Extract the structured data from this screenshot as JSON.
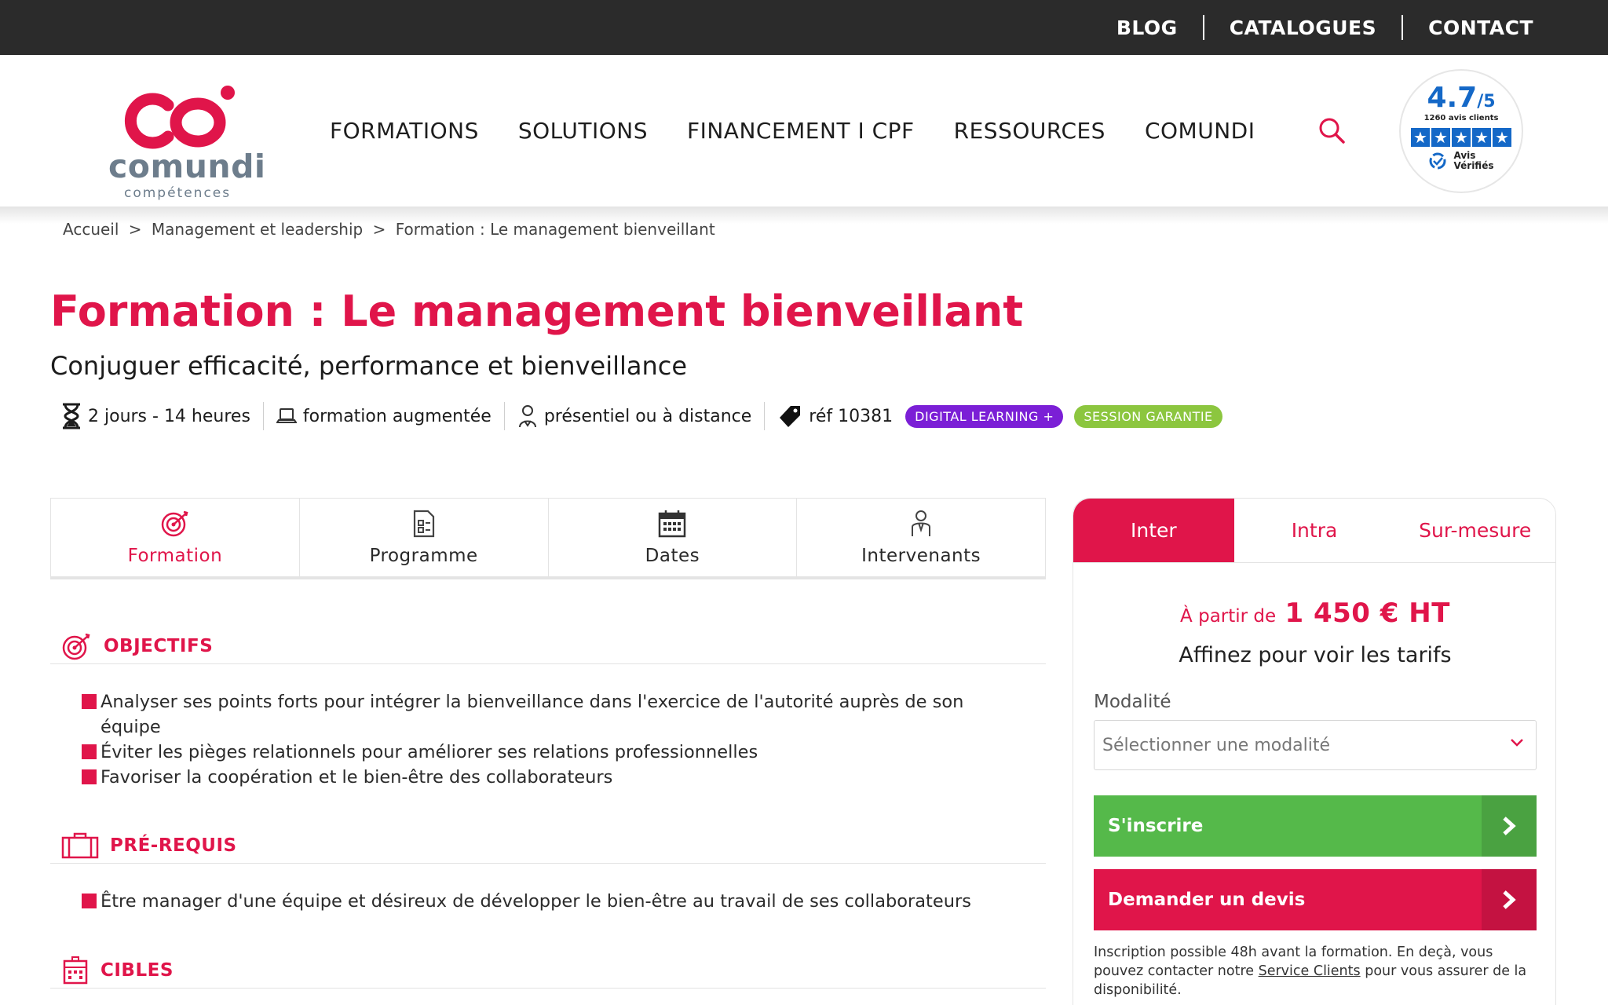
{
  "topbar": {
    "links": [
      "BLOG",
      "CATALOGUES",
      "CONTACT"
    ]
  },
  "logo": {
    "brand": "comundi",
    "sub": "compétences"
  },
  "nav": {
    "items": [
      "FORMATIONS",
      "SOLUTIONS",
      "FINANCEMENT I CPF",
      "RESSOURCES",
      "COMUNDI"
    ]
  },
  "rating": {
    "score": "4.7",
    "scale": "/5",
    "count": "1260 avis clients",
    "stars": 5,
    "brand_line1": "Avis",
    "brand_line2": "Vérifiés"
  },
  "breadcrumb": {
    "home": "Accueil",
    "sep": ">",
    "category": "Management et leadership",
    "current": "Formation : Le management bienveillant"
  },
  "title": "Formation : Le management bienveillant",
  "subtitle": "Conjuguer efficacité, performance et bienveillance",
  "meta": {
    "duration": "2 jours - 14 heures",
    "type": "formation augmentée",
    "mode": "présentiel ou à distance",
    "ref": "réf 10381",
    "badge_digital": "DIGITAL LEARNING +",
    "badge_session": "SESSION GARANTIE"
  },
  "tabs": [
    "Formation",
    "Programme",
    "Dates",
    "Intervenants"
  ],
  "sections": {
    "objectifs": {
      "title": "OBJECTIFS",
      "items": [
        "Analyser ses points forts pour intégrer la bienveillance dans l'exercice de l'autorité auprès de son équipe",
        "Éviter les pièges relationnels pour améliorer ses relations professionnelles",
        "Favoriser la coopération et le bien-être des collaborateurs"
      ]
    },
    "prerequis": {
      "title": "PRÉ-REQUIS",
      "items": [
        "Être manager d'une équipe et désireux de développer le bien-être au travail de ses collaborateurs"
      ]
    },
    "cibles": {
      "title": "CIBLES"
    }
  },
  "panel": {
    "tabs": [
      "Inter",
      "Intra",
      "Sur-mesure"
    ],
    "price_prefix": "À partir de",
    "price": "1 450 € HT",
    "refine": "Affinez pour voir les tarifs",
    "modalite_label": "Modalité",
    "modalite_placeholder": "Sélectionner une modalité",
    "btn_inscrire": "S'inscrire",
    "btn_devis": "Demander un devis",
    "note_before": "Inscription possible 48h avant la formation. En deçà, vous pouvez contacter notre",
    "note_link": "Service Clients",
    "note_after": "pour vous assurer de la disponibilité."
  },
  "colors": {
    "brand": "#e0154a",
    "dark": "#2b2b2b",
    "green": "#55b94a",
    "purple": "#7b1fd6",
    "lime": "#8cc63f",
    "rating_blue": "#1468c7"
  }
}
